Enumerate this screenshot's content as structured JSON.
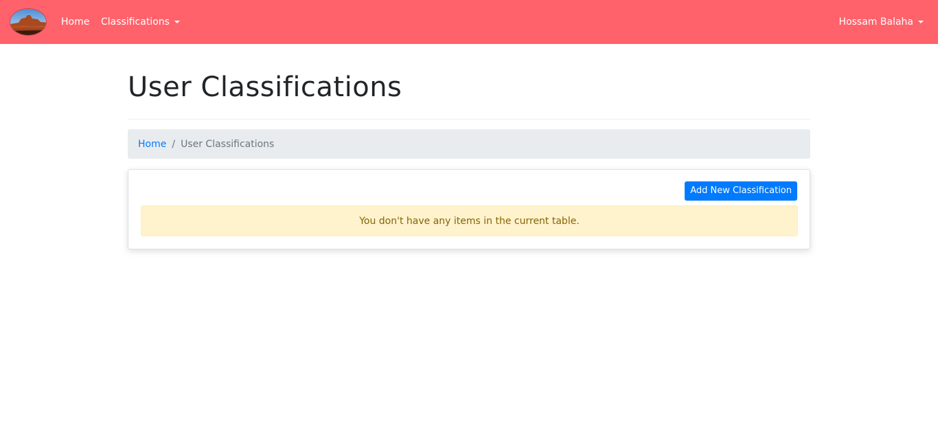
{
  "navbar": {
    "background_color": "#ff626b",
    "logo_icon": "landscape-logo-icon",
    "home_label": "Home",
    "classifications_label": "Classifications",
    "user_label": "Hossam Balaha"
  },
  "page": {
    "title": "User Classifications"
  },
  "breadcrumb": {
    "home_label": "Home",
    "separator": "/",
    "current_label": "User Classifications"
  },
  "card": {
    "add_button_label": "Add New Classification",
    "empty_message": "You don't have any items in the current table."
  },
  "colors": {
    "primary": "#007bff",
    "warning_bg": "#fff3cd",
    "warning_text": "#856404"
  }
}
